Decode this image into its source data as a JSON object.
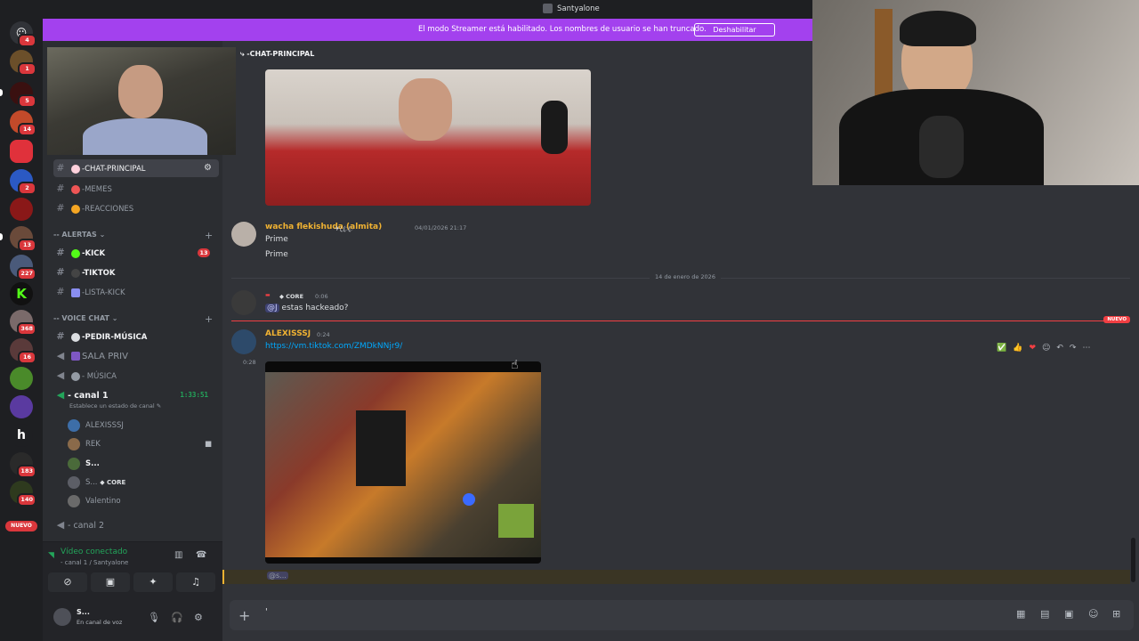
{
  "titlebar": {
    "title": "Santyalone"
  },
  "banner": {
    "text": "El modo Streamer está habilitado. Los nombres de usuario se han truncado.",
    "button": "Deshabilitar"
  },
  "server_rail": {
    "badges": [
      "4",
      "1",
      "5",
      "14",
      "2",
      "13",
      "227",
      "368",
      "16",
      "183",
      "140"
    ],
    "nuevo": "NUEVO"
  },
  "sidebar": {
    "channels": [
      {
        "label": "-CHAT-PRINCIPAL",
        "active": true
      },
      {
        "label": "-MEMES"
      },
      {
        "label": "-REACCIONES"
      }
    ],
    "alertas_category": "-- ALERTAS",
    "alertas": [
      {
        "label": "-KICK",
        "badge": "13"
      },
      {
        "label": "-TIKTOK"
      },
      {
        "label": "-LISTA-KICK"
      }
    ],
    "voice_category": "-- VOICE CHAT",
    "voice_channels": [
      {
        "label": "-PEDIR-MÚSICA"
      },
      {
        "label": "SALA PRIV"
      },
      {
        "label": "- MÚSICA"
      },
      {
        "label": "- canal 1",
        "timer": "1:33:51"
      }
    ],
    "channel_status": "Establece un estado de canal",
    "voice_users": [
      "ALEXISSSJ",
      "REK",
      "S...",
      "S...",
      "Valentino"
    ],
    "voice_user_core": "CORE",
    "canal2": "- canal 2"
  },
  "voice_panel": {
    "title": "Vídeo conectado",
    "subtitle": "- canal 1 / Santyalone",
    "user_name": "S...",
    "user_status": "En canal de voz"
  },
  "chat": {
    "header": "-CHAT-PRINCIPAL",
    "messages": [
      {
        "author": "wacha flekishuda (almita)",
        "tag": "✈ ꦿꦿꦿ",
        "time": "04/01/2026 21:17",
        "lines": [
          "Prime",
          "Prime"
        ]
      },
      {
        "author": "",
        "role": "CORE",
        "time": "0:06",
        "mention": "@J",
        "text": "estas hackeado?"
      },
      {
        "author": "ALEXISSSJ",
        "time": "0:24",
        "link": "https://vm.tiktok.com/ZMDkNNjr9/",
        "side_time": "0:28"
      }
    ],
    "date_separator": "14 de enero de 2026",
    "new_label": "NUEVO",
    "reply_mention": "@s..."
  },
  "colors": {
    "accent": "#5865f2",
    "streamer_banner": "#a341ee",
    "gold_name": "#f0b232",
    "online": "#23a55a",
    "danger": "#da373c"
  }
}
